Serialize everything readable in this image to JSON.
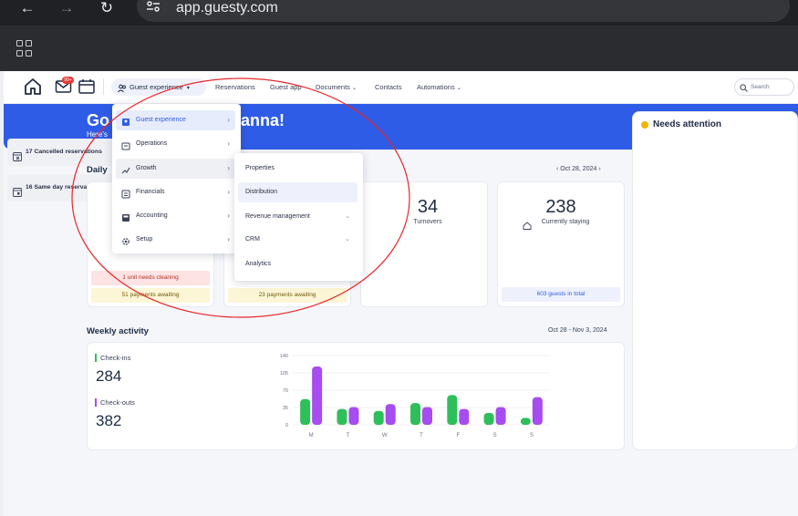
{
  "browser": {
    "url": "app.guesty.com",
    "back_label": "←",
    "forward_label": "→",
    "reload_label": "↻"
  },
  "nav": {
    "mail_badge": "99+",
    "pill_label": "Guest experience",
    "items": [
      "Reservations",
      "Guest app",
      "Documents",
      "Contacts",
      "Automations"
    ],
    "search_placeholder": "Search"
  },
  "hero": {
    "greeting_left": "Go",
    "greeting_right": "anna!",
    "subtitle_left": "Here's"
  },
  "needs_attention": {
    "title": "Needs attention",
    "items": [
      "17 Cancelled reservations",
      "16 Same day reservations"
    ]
  },
  "daily": {
    "title_partial": "Daily",
    "date": "Oct 28, 2024",
    "prev": "‹",
    "next": "›",
    "cards": [
      {
        "value": "",
        "label": "",
        "chips": [
          "1 unit needs cleaning",
          "51 payments awaiting"
        ]
      },
      {
        "value": "",
        "label": "",
        "chips": [
          "23 payments awaiting"
        ]
      },
      {
        "value": "34",
        "label": "Turnovers"
      },
      {
        "value": "238",
        "label": "Currently staying",
        "chips": [
          "603 guests in total"
        ]
      }
    ]
  },
  "menu": {
    "items": [
      {
        "label": "Guest experience",
        "icon": "guest-experience-icon"
      },
      {
        "label": "Operations",
        "icon": "operations-icon"
      },
      {
        "label": "Growth",
        "icon": "growth-icon"
      },
      {
        "label": "Financials",
        "icon": "financials-icon"
      },
      {
        "label": "Accounting",
        "icon": "accounting-icon"
      },
      {
        "label": "Setup",
        "icon": "gear-icon"
      }
    ],
    "submenu": [
      "Properties",
      "Distribution",
      "Revenue management",
      "CRM",
      "Analytics"
    ]
  },
  "weekly": {
    "title": "Weekly activity",
    "range": "Oct 28 - Nov 3, 2024",
    "checkins_label": "Check-ins",
    "checkins_value": "284",
    "checkouts_label": "Check-outs",
    "checkouts_value": "382"
  },
  "colors": {
    "brand": "#2f5ce6",
    "checkins": "#2fbf5a",
    "checkouts": "#a64cf0",
    "annotation": "#e8262b"
  },
  "chart_data": {
    "type": "bar",
    "categories": [
      "M",
      "T",
      "W",
      "T",
      "F",
      "S",
      "S"
    ],
    "yticks": [
      0,
      35,
      70,
      105,
      140
    ],
    "ylim": [
      0,
      140
    ],
    "series": [
      {
        "name": "Check-ins",
        "values": [
          52,
          32,
          28,
          44,
          60,
          24,
          14
        ]
      },
      {
        "name": "Check-outs",
        "values": [
          118,
          36,
          42,
          36,
          32,
          36,
          56
        ]
      }
    ]
  }
}
